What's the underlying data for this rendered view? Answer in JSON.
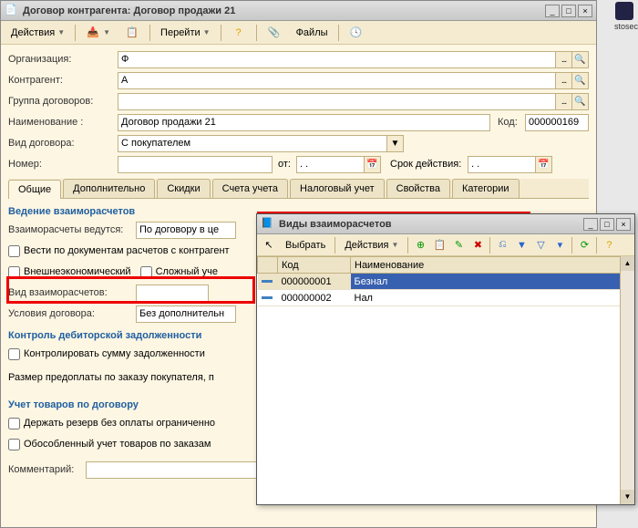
{
  "main": {
    "title": "Договор контрагента: Договор продажи 21",
    "toolbar": {
      "actions": "Действия",
      "goto": "Перейти",
      "files": "Файлы"
    },
    "fields": {
      "org_lbl": "Организация:",
      "org_val": "Ф",
      "contr_lbl": "Контрагент:",
      "contr_val": "А",
      "group_lbl": "Группа договоров:",
      "group_val": "",
      "name_lbl": "Наименование :",
      "name_val": "Договор продажи 21",
      "code_lbl": "Код:",
      "code_val": "000000169",
      "kind_lbl": "Вид договора:",
      "kind_val": "С покупателем",
      "num_lbl": "Номер:",
      "num_val": "",
      "from_lbl": "от:",
      "from_val": ". .",
      "valid_lbl": "Срок действия:",
      "valid_val": ". ."
    },
    "tabs": [
      "Общие",
      "Дополнительно",
      "Скидки",
      "Счета учета",
      "Налоговый учет",
      "Свойства",
      "Категории"
    ],
    "section1": "Ведение взаиморасчетов",
    "calc_lbl": "Взаиморасчеты ведутся:",
    "calc_val": "По договору в це",
    "docs_lbl": "Вести по документам расчетов с контрагент",
    "foreign_lbl": "Внешнеэкономический",
    "complex_lbl": "Сложный уче",
    "calctype_lbl": "Вид взаиморасчетов:",
    "calctype_val": "",
    "cond_lbl": "Условия договора:",
    "cond_val": "Без дополнительн",
    "section2": "Контроль дебиторской задолженности",
    "ctrl_lbl": "Контролировать сумму задолженности",
    "prepay_lbl": "Размер предоплаты по заказу покупателя, п",
    "section3": "Учет товаров по договору",
    "reserve_lbl": "Держать резерв без оплаты ограниченно",
    "sep_lbl": "Обособленный учет товаров по заказам",
    "comment_lbl": "Комментарий:"
  },
  "popup": {
    "title": "Виды взаиморасчетов",
    "toolbar": {
      "select": "Выбрать",
      "actions": "Действия"
    },
    "cols": {
      "code": "Код",
      "name": "Наименование"
    },
    "rows": [
      {
        "code": "000000001",
        "name": "Безнал"
      },
      {
        "code": "000000002",
        "name": "Нал"
      }
    ]
  },
  "brand": "stosec"
}
